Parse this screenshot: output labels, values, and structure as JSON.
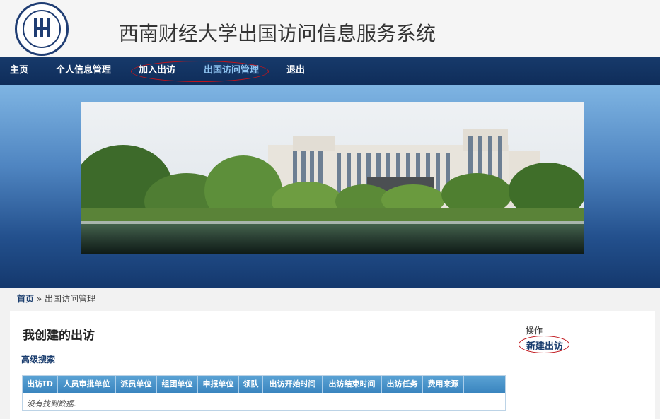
{
  "header": {
    "title": "西南财经大学出国访问信息服务系统"
  },
  "nav": {
    "items": [
      {
        "label": "主页"
      },
      {
        "label": "个人信息管理"
      },
      {
        "label": "加入出访"
      },
      {
        "label": "出国访问管理"
      },
      {
        "label": "退出"
      }
    ]
  },
  "breadcrumb": {
    "home": "首页",
    "separator": "»",
    "current": "出国访问管理"
  },
  "main": {
    "heading": "我创建的出访",
    "advanced_search": "高级搜索",
    "table": {
      "columns": [
        "出访ID",
        "人员审批单位",
        "派员单位",
        "组团单位",
        "申报单位",
        "领队",
        "出访开始时间",
        "出访结束时间",
        "出访任务",
        "费用来源"
      ],
      "empty_message": "没有找到数据."
    }
  },
  "sidebar": {
    "operations_label": "操作",
    "new_visit": "新建出访"
  },
  "colors": {
    "nav_bg": "#173a6b",
    "active_nav": "#8fc3f0",
    "link": "#1a3d6e",
    "highlight": "#c0161c"
  }
}
